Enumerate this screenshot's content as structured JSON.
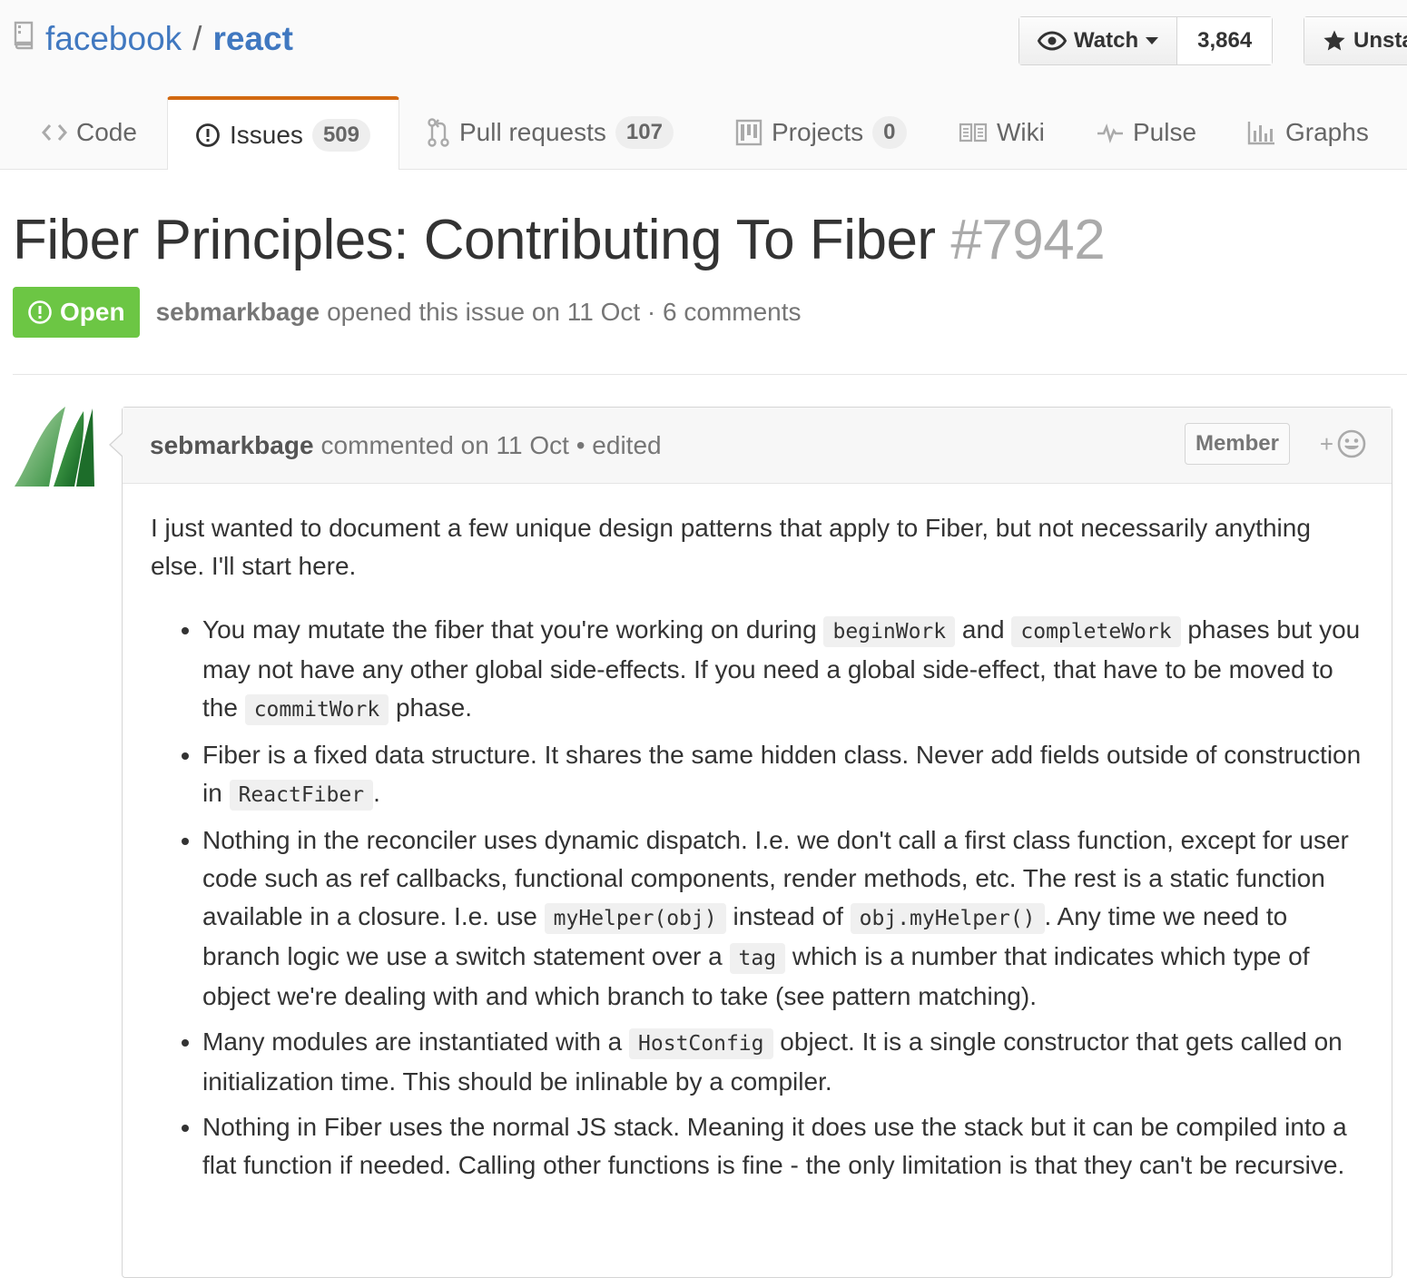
{
  "repo": {
    "owner": "facebook",
    "separator": "/",
    "name": "react"
  },
  "actions": {
    "watch_label": "Watch",
    "watch_count": "3,864",
    "star_label": "Unstar"
  },
  "tabs": [
    {
      "label": "Code",
      "icon": "code-icon"
    },
    {
      "label": "Issues",
      "icon": "issue-opened-icon",
      "count": "509",
      "selected": true
    },
    {
      "label": "Pull requests",
      "icon": "git-pull-request-icon",
      "count": "107"
    },
    {
      "label": "Projects",
      "icon": "project-icon",
      "count": "0"
    },
    {
      "label": "Wiki",
      "icon": "book-icon"
    },
    {
      "label": "Pulse",
      "icon": "pulse-icon"
    },
    {
      "label": "Graphs",
      "icon": "graph-icon"
    }
  ],
  "issue": {
    "title": "Fiber Principles: Contributing To Fiber",
    "number": "#7942",
    "state": "Open",
    "author": "sebmarkbage",
    "meta_text": "opened this issue on 11 Oct · 6 comments"
  },
  "comment": {
    "author": "sebmarkbage",
    "meta_text": "commented on 11 Oct • edited",
    "badge": "Member",
    "reaction_plus": "+",
    "intro": "I just wanted to document a few unique design patterns that apply to Fiber, but not necessarily anything else. I'll start here.",
    "bullets": [
      {
        "t1": "You may mutate the fiber that you're working on during ",
        "c1": "beginWork",
        "t2": " and ",
        "c2": "completeWork",
        "t3": " phases but you may not have any other global side-effects. If you need a global side-effect, that have to be moved to the ",
        "c3": "commitWork",
        "t4": " phase."
      },
      {
        "t1": "Fiber is a fixed data structure. It shares the same hidden class. Never add fields outside of construction in ",
        "c1": "ReactFiber",
        "t2": "."
      },
      {
        "t1": "Nothing in the reconciler uses dynamic dispatch. I.e. we don't call a first class function, except for user code such as ref callbacks, functional components, render methods, etc. The rest is a static function available in a closure. I.e. use ",
        "c1": "myHelper(obj)",
        "t2": " instead of ",
        "c2": "obj.myHelper()",
        "t3": ". Any time we need to branch logic we use a switch statement over a ",
        "c3": "tag",
        "t4": " which is a number that indicates which type of object we're dealing with and which branch to take (see pattern matching)."
      },
      {
        "t1": "Many modules are instantiated with a ",
        "c1": "HostConfig",
        "t2": " object. It is a single constructor that gets called on initialization time. This should be inlinable by a compiler."
      },
      {
        "t1": "Nothing in Fiber uses the normal JS stack. Meaning it does use the stack but it can be compiled into a flat function if needed. Calling other functions is fine - the only limitation is that they can't be recursive."
      }
    ]
  },
  "colors": {
    "link": "#4078c0",
    "open_green": "#6cc644",
    "tab_accent": "#d26911",
    "muted": "#767676"
  }
}
